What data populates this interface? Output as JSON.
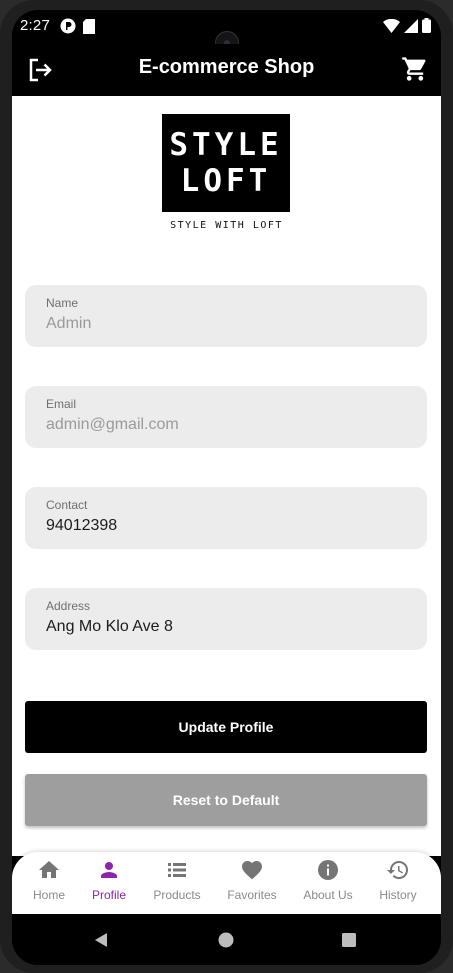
{
  "status_bar": {
    "time": "2:27",
    "left_icons": [
      "notification-app-icon",
      "sd-card-icon"
    ],
    "right_icons": [
      "wifi-icon",
      "cell-signal-icon",
      "battery-icon"
    ]
  },
  "app_bar": {
    "title": "E-commerce Shop",
    "leading_icon": "logout-icon",
    "trailing_icon": "shopping-cart-icon"
  },
  "logo": {
    "line1": "STYLE",
    "line2": "LOFT",
    "tagline": "STYLE WITH LOFT"
  },
  "form": {
    "name": {
      "label": "Name",
      "value": "Admin",
      "enabled": false
    },
    "email": {
      "label": "Email",
      "value": "admin@gmail.com",
      "enabled": false
    },
    "contact": {
      "label": "Contact",
      "value": "94012398",
      "enabled": true
    },
    "address": {
      "label": "Address",
      "value": "Ang Mo Klo Ave 8",
      "enabled": true
    }
  },
  "buttons": {
    "update": "Update Profile",
    "reset": "Reset to Default"
  },
  "bottom_nav": {
    "active": "Profile",
    "items": [
      {
        "label": "Home",
        "icon": "home-icon"
      },
      {
        "label": "Profile",
        "icon": "person-icon"
      },
      {
        "label": "Products",
        "icon": "list-icon"
      },
      {
        "label": "Favorites",
        "icon": "heart-icon"
      },
      {
        "label": "About Us",
        "icon": "info-icon"
      },
      {
        "label": "History",
        "icon": "history-icon"
      }
    ]
  },
  "system_nav": [
    "back-icon",
    "home-circle-icon",
    "recents-icon"
  ],
  "colors": {
    "app_bar_bg": "#000000",
    "accent": "#8e24aa",
    "field_bg": "#ececec",
    "update_button_bg": "#000000",
    "reset_button_bg": "#9e9e9e"
  }
}
